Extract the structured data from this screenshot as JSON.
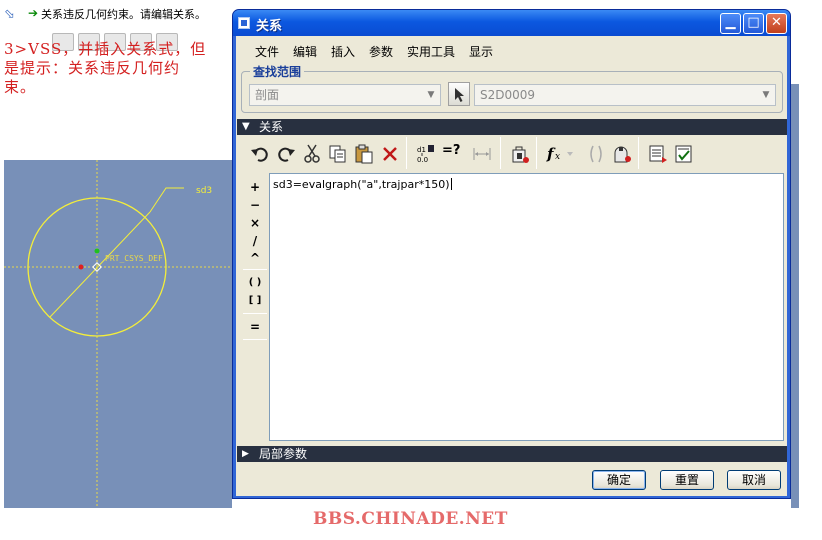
{
  "background": {
    "message": "关系违反几何约束。请编辑关系。",
    "annotation_lines": [
      "3>VSS，并插入关系式，但",
      "是提示：关系违反几何约",
      "束。"
    ],
    "dimension_label": "sd3",
    "csys_label": "PRT_CSYS_DEF",
    "watermark": "BBS.CHINADE.NET"
  },
  "dialog": {
    "title": "关系",
    "menu": [
      "文件",
      "编辑",
      "插入",
      "参数",
      "实用工具",
      "显示"
    ],
    "lookin": {
      "legend": "查找范围",
      "type_value": "剖面",
      "object_value": "S2D0009"
    },
    "relations_header": "关系",
    "toolbar": {
      "icons": [
        "undo-icon",
        "redo-icon",
        "cut-icon",
        "copy-icon",
        "paste-icon",
        "delete-icon",
        "switch-dims-icon",
        "verify-icon",
        "measure-icon",
        "locked-params-icon",
        "function-icon",
        "bracket-icon",
        "evaluate-icon",
        "sort-icon",
        "verify-relations-icon"
      ],
      "verify_text": "=?"
    },
    "operators": [
      "+",
      "−",
      "×",
      "/",
      "^",
      "( )",
      "[ ]",
      "="
    ],
    "editor_text": "sd3=evalgraph(\"a\",trajpar*150)",
    "local_params_header": "局部参数",
    "buttons": {
      "ok": "确定",
      "reset": "重置",
      "cancel": "取消"
    }
  },
  "colors": {
    "title_bar": "#0b58e0",
    "dialog_face": "#ece9d8",
    "section_header": "#283040",
    "cad_background": "#7890b8",
    "annotation_red": "#d42020"
  }
}
